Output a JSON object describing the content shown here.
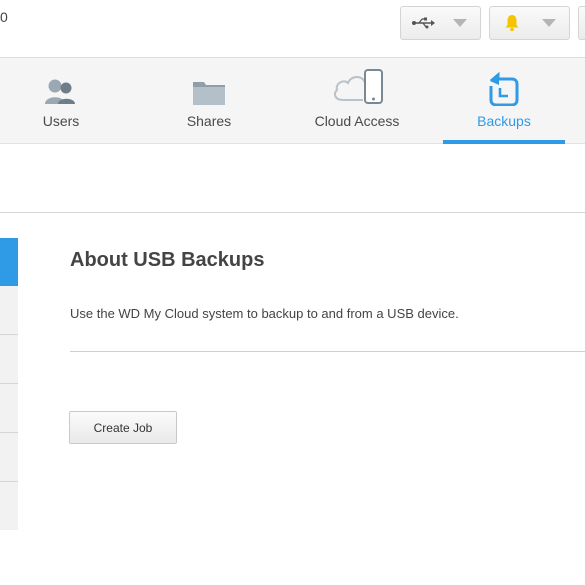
{
  "topbar": {
    "left_text_fragment": "0",
    "usb_icon": "usb-icon",
    "alert_icon": "bell-icon",
    "caret_icon": "chevron-down-icon",
    "alert_color": "#f5c400"
  },
  "nav": {
    "items": [
      {
        "label": "Users",
        "icon": "users-icon"
      },
      {
        "label": "Shares",
        "icon": "folder-icon"
      },
      {
        "label": "Cloud Access",
        "icon": "cloud-device-icon"
      },
      {
        "label": "Backups",
        "icon": "backup-icon"
      }
    ],
    "active": "Backups",
    "accent_color": "#2f9ae6"
  },
  "sidebar": {
    "item_count": 6,
    "active_index": 0
  },
  "main": {
    "title": "About USB Backups",
    "description": "Use the WD My Cloud system to backup to and from a USB device.",
    "create_button_label": "Create Job"
  }
}
